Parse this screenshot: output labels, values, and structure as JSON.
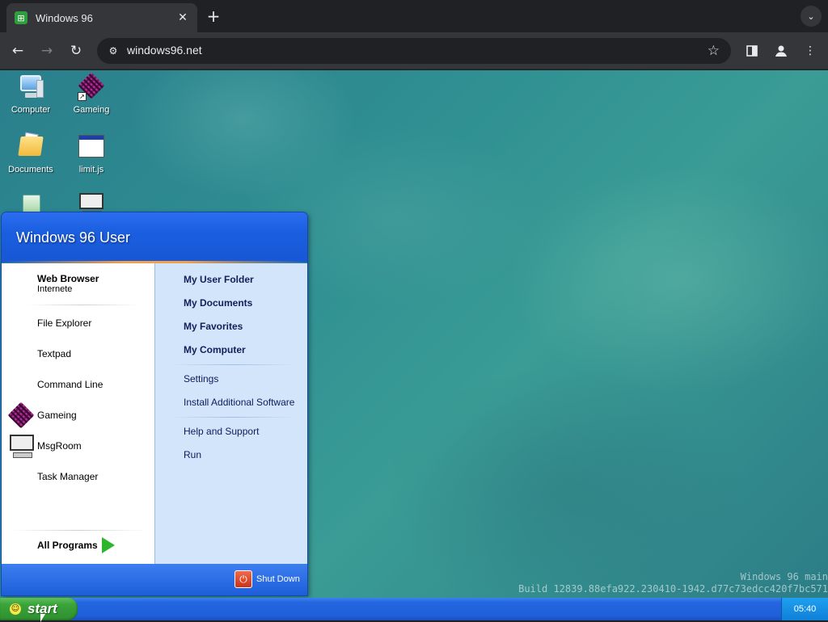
{
  "browser": {
    "tab_title": "Windows 96",
    "tab_favicon": "windows96-favicon",
    "close_glyph": "✕",
    "new_tab_glyph": "+",
    "tab_menu_glyph": "⌄",
    "url": "windows96.net",
    "icons": [
      "back-icon",
      "forward-icon",
      "reload-icon",
      "site-info-icon",
      "bookmark-star-icon",
      "side-panel-icon",
      "profile-icon",
      "menu-icon"
    ]
  },
  "desktop": {
    "icons": [
      {
        "label": "Computer",
        "icon": "computer-icon"
      },
      {
        "label": "Gameing",
        "icon": "cube-icon"
      },
      {
        "label": "Documents",
        "icon": "documents-folder-icon"
      },
      {
        "label": "limit.js",
        "icon": "window-file-icon"
      },
      {
        "label": "",
        "icon": "recycle-bin-icon"
      },
      {
        "label": "",
        "icon": "msgroom-icon"
      }
    ],
    "watermark_line1": "Windows 96 main",
    "watermark_line2": "Build 12839.88efa922.230410-1942.d77c73edcc420f7bc571"
  },
  "start_menu": {
    "user_name": "Windows 96 User",
    "pinned": {
      "title": "Web Browser",
      "subtitle": "Internete"
    },
    "left_items": [
      "File Explorer",
      "Textpad",
      "Command Line",
      "Gameing",
      "MsgRoom",
      "Task Manager"
    ],
    "all_programs": "All Programs",
    "right_bold": [
      "My User Folder",
      "My Documents",
      "My Favorites",
      "My Computer"
    ],
    "right_items": [
      "Settings",
      "Install Additional Software"
    ],
    "right_help": [
      "Help and Support",
      "Run"
    ],
    "shutdown_label": "Shut Down"
  },
  "taskbar": {
    "start_label": "start",
    "clock": "05:40"
  },
  "colors": {
    "xp_blue": "#1f5fd8",
    "start_green": "#3aa43a",
    "desktop_teal": "#2f8f92"
  }
}
